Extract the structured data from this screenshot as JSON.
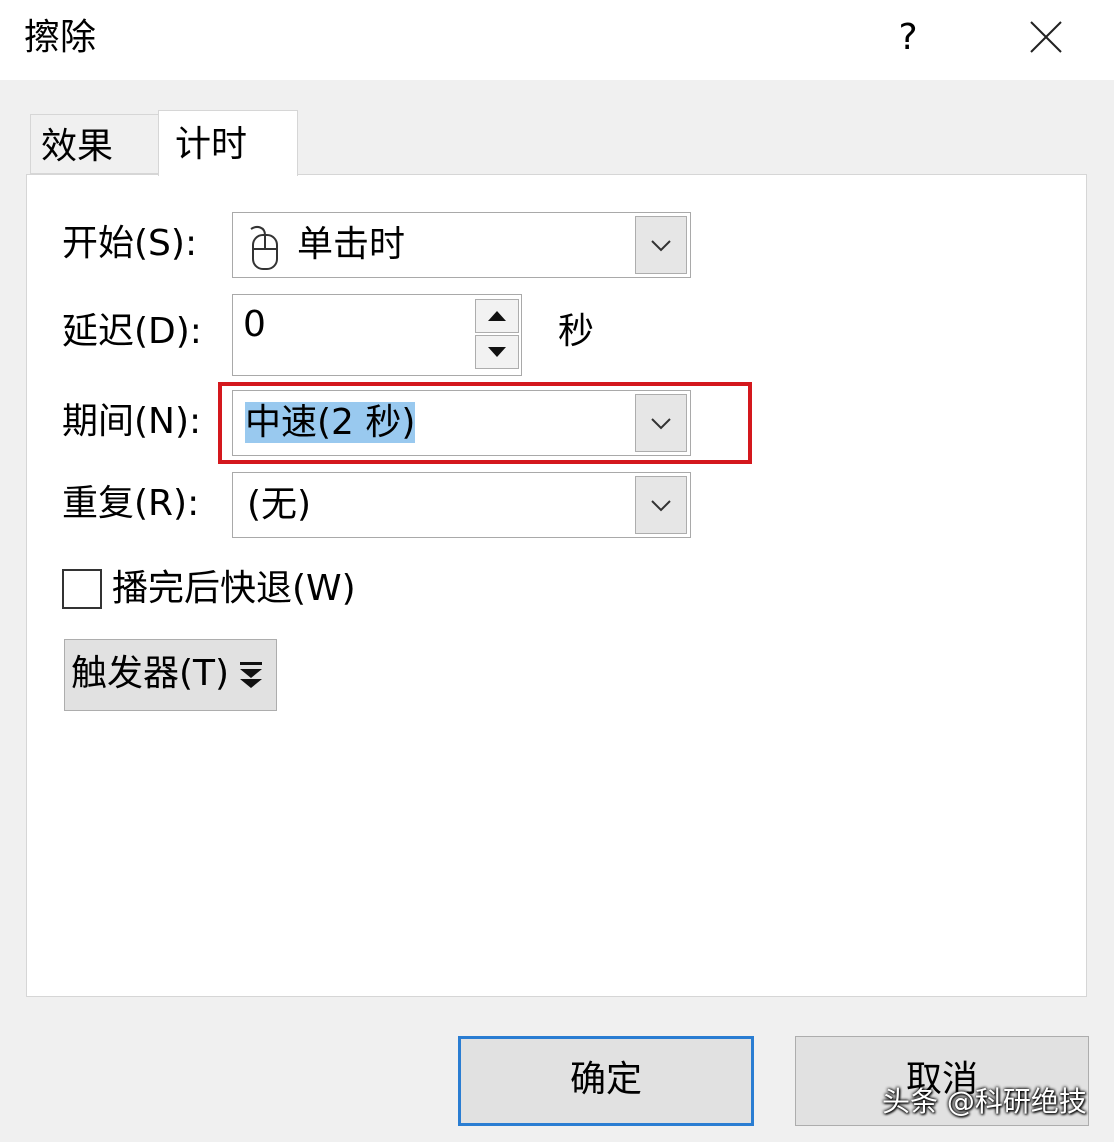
{
  "dialog": {
    "title": "擦除",
    "help": "?"
  },
  "tabs": [
    {
      "label": "效果",
      "active": false
    },
    {
      "label": "计时",
      "active": true
    }
  ],
  "fields": {
    "start": {
      "label": "开始(S):",
      "value": "单击时",
      "icon": "mouse-icon"
    },
    "delay": {
      "label": "延迟(D):",
      "value": "0",
      "unit": "秒"
    },
    "duration": {
      "label": "期间(N):",
      "value": "中速(2 秒)"
    },
    "repeat": {
      "label": "重复(R):",
      "value": "(无)"
    },
    "rewind": {
      "label": "播完后快退(W)",
      "checked": false
    }
  },
  "trigger": {
    "label": "触发器(T)"
  },
  "buttons": {
    "ok": "确定",
    "cancel": "取消"
  },
  "watermark": "头条 @科研绝技",
  "colors": {
    "highlight_border": "#d4181d",
    "selection": "#99c9ef",
    "ok_border": "#2a7dd2"
  }
}
